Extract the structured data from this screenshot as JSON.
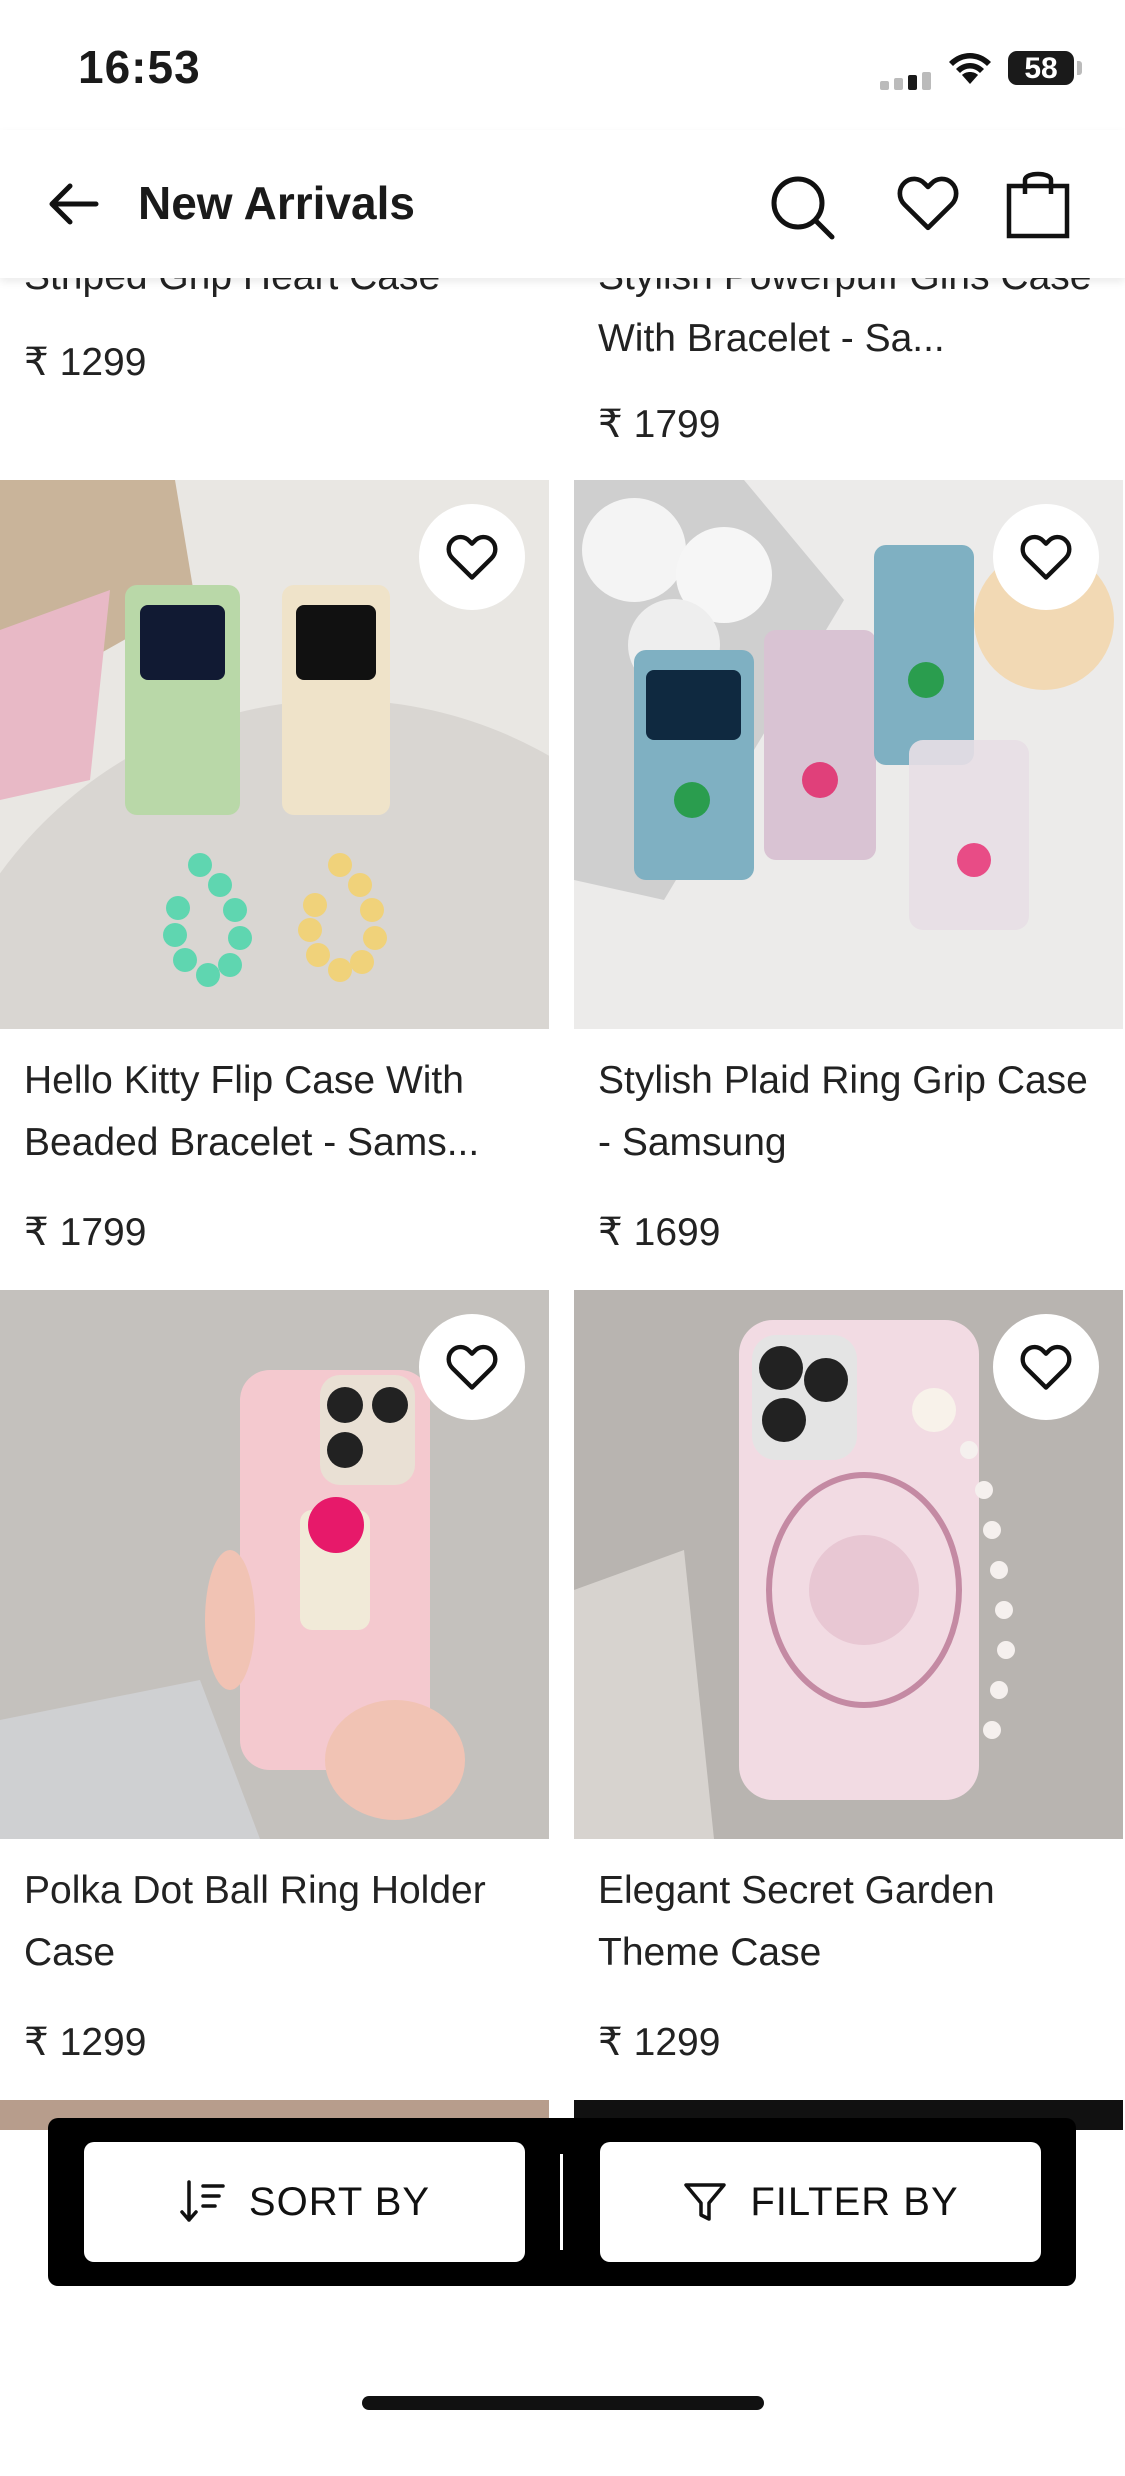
{
  "status_bar": {
    "time": "16:53",
    "battery": "58"
  },
  "header": {
    "title": "New Arrivals"
  },
  "products": [
    {
      "name": "Striped Grip Heart Case",
      "price": "₹ 1299"
    },
    {
      "name": "Stylish Powerpuff Girls Case With Bracelet - Sa...",
      "price": "₹ 1799"
    },
    {
      "name": "Hello Kitty Flip Case With Beaded Bracelet - Sams...",
      "price": "₹ 1799"
    },
    {
      "name": "Stylish Plaid Ring Grip Case - Samsung",
      "price": "₹ 1699"
    },
    {
      "name": "Polka Dot Ball Ring Holder Case",
      "price": "₹ 1299"
    },
    {
      "name": "Elegant Secret Garden Theme Case",
      "price": "₹ 1299"
    }
  ],
  "actions": {
    "sort_label": "SORT BY",
    "filter_label": "FILTER BY"
  },
  "colors": {
    "background": "#ffffff",
    "text": "#1a1a1a",
    "action_bar": "#000000"
  }
}
